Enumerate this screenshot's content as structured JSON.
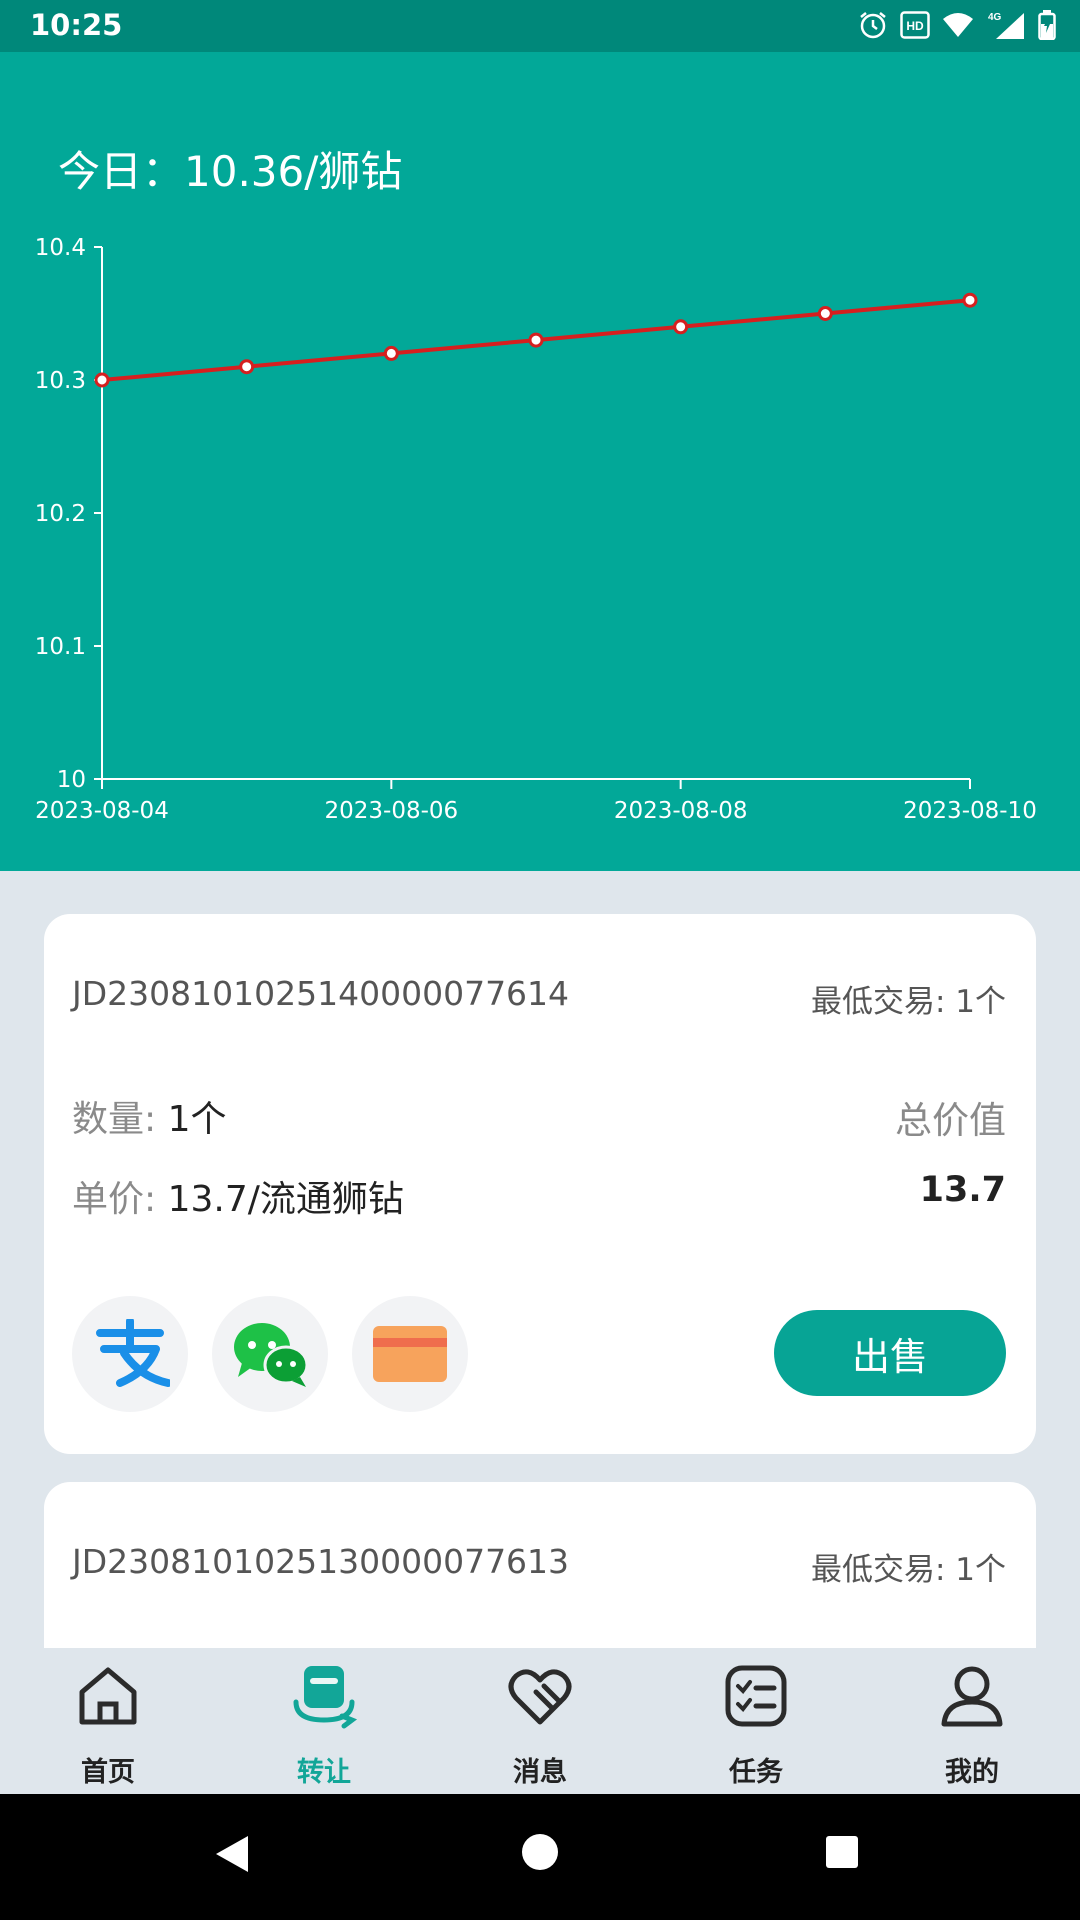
{
  "status_bar": {
    "time": "10:25",
    "network": "4G"
  },
  "header": {
    "today_label": "今日：10.36/狮钻"
  },
  "chart_data": {
    "type": "line",
    "x": [
      "2023-08-04",
      "2023-08-05",
      "2023-08-06",
      "2023-08-07",
      "2023-08-08",
      "2023-08-09",
      "2023-08-10"
    ],
    "series": [
      {
        "values": [
          10.3,
          10.31,
          10.32,
          10.33,
          10.34,
          10.35,
          10.36
        ],
        "color": "#d61f1f"
      }
    ],
    "x_tick_labels": [
      "2023-08-04",
      "2023-08-06",
      "2023-08-08",
      "2023-08-10"
    ],
    "y_tick_labels": [
      "10.4",
      "10.3",
      "10.2",
      "10.1",
      "10"
    ],
    "ylim": [
      10,
      10.4
    ],
    "grid": false,
    "colors": {
      "background": "#02a898",
      "axis": "#ffffff",
      "line": "#d61f1f"
    }
  },
  "orders": [
    {
      "id": "JD23081010251400000776​14",
      "min_trade": "最低交易: 1个",
      "qty_label": "数量:",
      "qty_value": "1个",
      "price_label": "单价:",
      "price_value": "13.7/流通狮钻",
      "total_label": "总价值",
      "total_value": "13.7",
      "payment_icons": [
        "alipay-icon",
        "wechat-icon",
        "bank-card-icon"
      ],
      "sell_label": "出售"
    },
    {
      "id": "JD23081010251300000776​13",
      "min_trade": "最低交易: 1个"
    }
  ],
  "tabs": [
    {
      "label": "首页",
      "icon": "home-icon"
    },
    {
      "label": "转让",
      "icon": "transfer-icon",
      "active": true
    },
    {
      "label": "消息",
      "icon": "message-icon"
    },
    {
      "label": "任务",
      "icon": "task-icon"
    },
    {
      "label": "我的",
      "icon": "profile-icon"
    }
  ],
  "colors": {
    "primary": "#02a898",
    "status_bar": "#00887a",
    "active_tab": "#12a698"
  }
}
